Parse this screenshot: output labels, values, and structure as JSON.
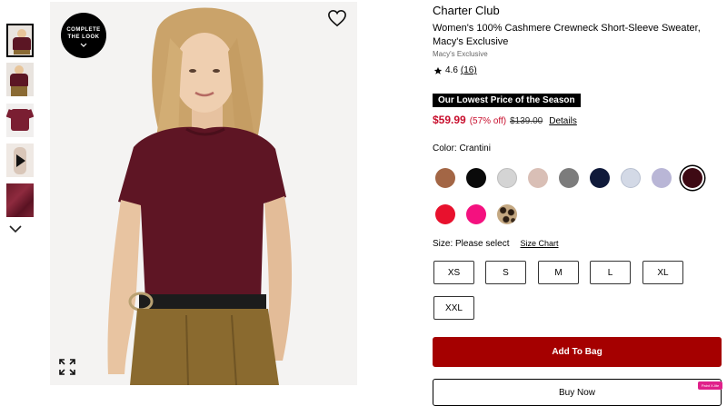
{
  "gallery": {
    "complete_look_label": "COMPLETE THE LOOK",
    "thumbnails": [
      "person-front",
      "person-front-small",
      "flat-lay",
      "video",
      "fabric-closeup"
    ]
  },
  "product": {
    "brand": "Charter Club",
    "title": "Women's 100% Cashmere Crewneck Short-Sleeve Sweater, Macy's Exclusive",
    "exclusive_label": "Macy's Exclusive",
    "rating_value": "4.6",
    "rating_count": "(16)",
    "promo_banner": "Our Lowest Price of the Season",
    "sale_price": "$59.99",
    "discount": "(57% off)",
    "original_price": "$139.00",
    "details_link": "Details",
    "color_label": "Color: Crantini",
    "colors": [
      {
        "name": "brown",
        "hex": "#a36645"
      },
      {
        "name": "black",
        "hex": "#0a0a0a"
      },
      {
        "name": "light-gray",
        "hex": "#d4d4d4"
      },
      {
        "name": "blush",
        "hex": "#d9bfb6"
      },
      {
        "name": "charcoal-gray",
        "hex": "#7c7c7c"
      },
      {
        "name": "navy",
        "hex": "#101a3a"
      },
      {
        "name": "pale-blue",
        "hex": "#d3d9e6"
      },
      {
        "name": "lavender",
        "hex": "#b9b6d6"
      },
      {
        "name": "crantini",
        "hex": "#3e0a14",
        "selected": true
      },
      {
        "name": "red",
        "hex": "#e8112d"
      },
      {
        "name": "pink",
        "hex": "#f4117f"
      },
      {
        "name": "leopard",
        "hex": "#a0856a"
      }
    ],
    "size_label": "Size: Please select",
    "size_chart_link": "Size Chart",
    "sizes": [
      "XS",
      "S",
      "M",
      "L",
      "XL",
      "XXL"
    ],
    "add_to_bag": "Add To Bag",
    "secondary_button": "Buy Now",
    "badge_text": "Paint X-lite"
  },
  "colors": {
    "accent_red": "#c8102e",
    "button_red": "#a50000"
  }
}
